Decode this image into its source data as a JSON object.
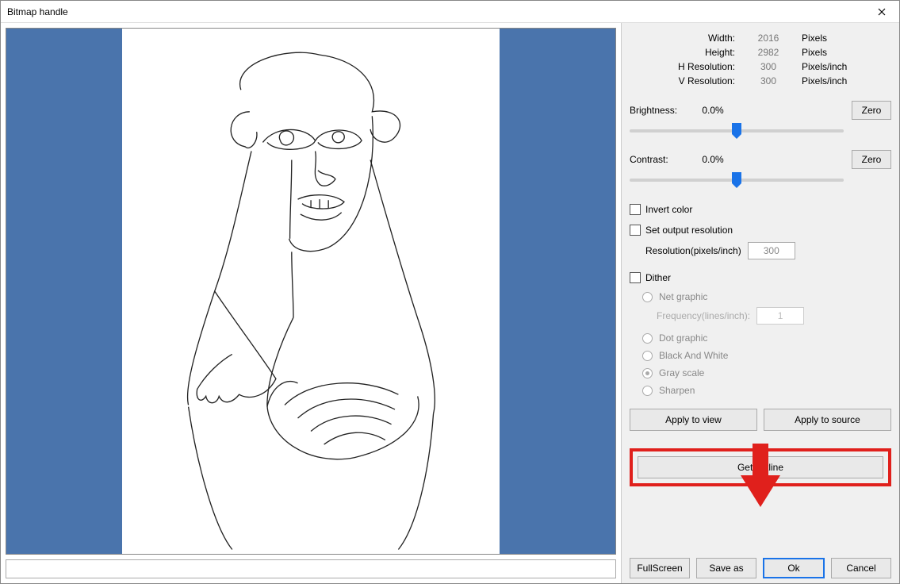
{
  "title": "Bitmap handle",
  "info": {
    "width_label": "Width:",
    "width_value": "2016",
    "width_unit": "Pixels",
    "height_label": "Height:",
    "height_value": "2982",
    "height_unit": "Pixels",
    "hres_label": "H Resolution:",
    "hres_value": "300",
    "hres_unit": "Pixels/inch",
    "vres_label": "V Resolution:",
    "vres_value": "300",
    "vres_unit": "Pixels/inch"
  },
  "brightness": {
    "label": "Brightness:",
    "value": "0.0%",
    "zero": "Zero"
  },
  "contrast": {
    "label": "Contrast:",
    "value": "0.0%",
    "zero": "Zero"
  },
  "invert_color_label": "Invert color",
  "set_output_res_label": "Set output resolution",
  "resolution_label": "Resolution(pixels/inch)",
  "resolution_value": "300",
  "dither_label": "Dither",
  "dither_options": {
    "net": "Net graphic",
    "freq_label": "Frequency(lines/inch):",
    "freq_value": "1",
    "dot": "Dot graphic",
    "bw": "Black And White",
    "gray": "Gray scale",
    "sharpen": "Sharpen"
  },
  "apply_view": "Apply to view",
  "apply_source": "Apply to source",
  "get_outline": "Get outline",
  "buttons": {
    "fullscreen": "FullScreen",
    "save_as": "Save as",
    "ok": "Ok",
    "cancel": "Cancel"
  }
}
